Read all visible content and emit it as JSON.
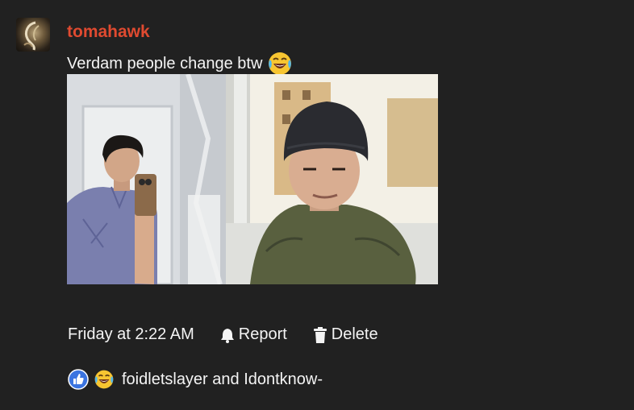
{
  "post": {
    "username": "tomahawk",
    "message": "Verdam people change btw",
    "message_emoji": "joy-emoji",
    "timestamp": "Friday at 2:22 AM",
    "actions": {
      "report_label": "Report",
      "delete_label": "Delete"
    },
    "reactions": {
      "icons": [
        "like-icon",
        "joy-emoji"
      ],
      "users_text": "foidletslayer and Idontknow-"
    }
  },
  "colors": {
    "background": "#212121",
    "username": "#e04a30",
    "text": "#f4f4f4",
    "like_blue": "#3b74e0"
  }
}
